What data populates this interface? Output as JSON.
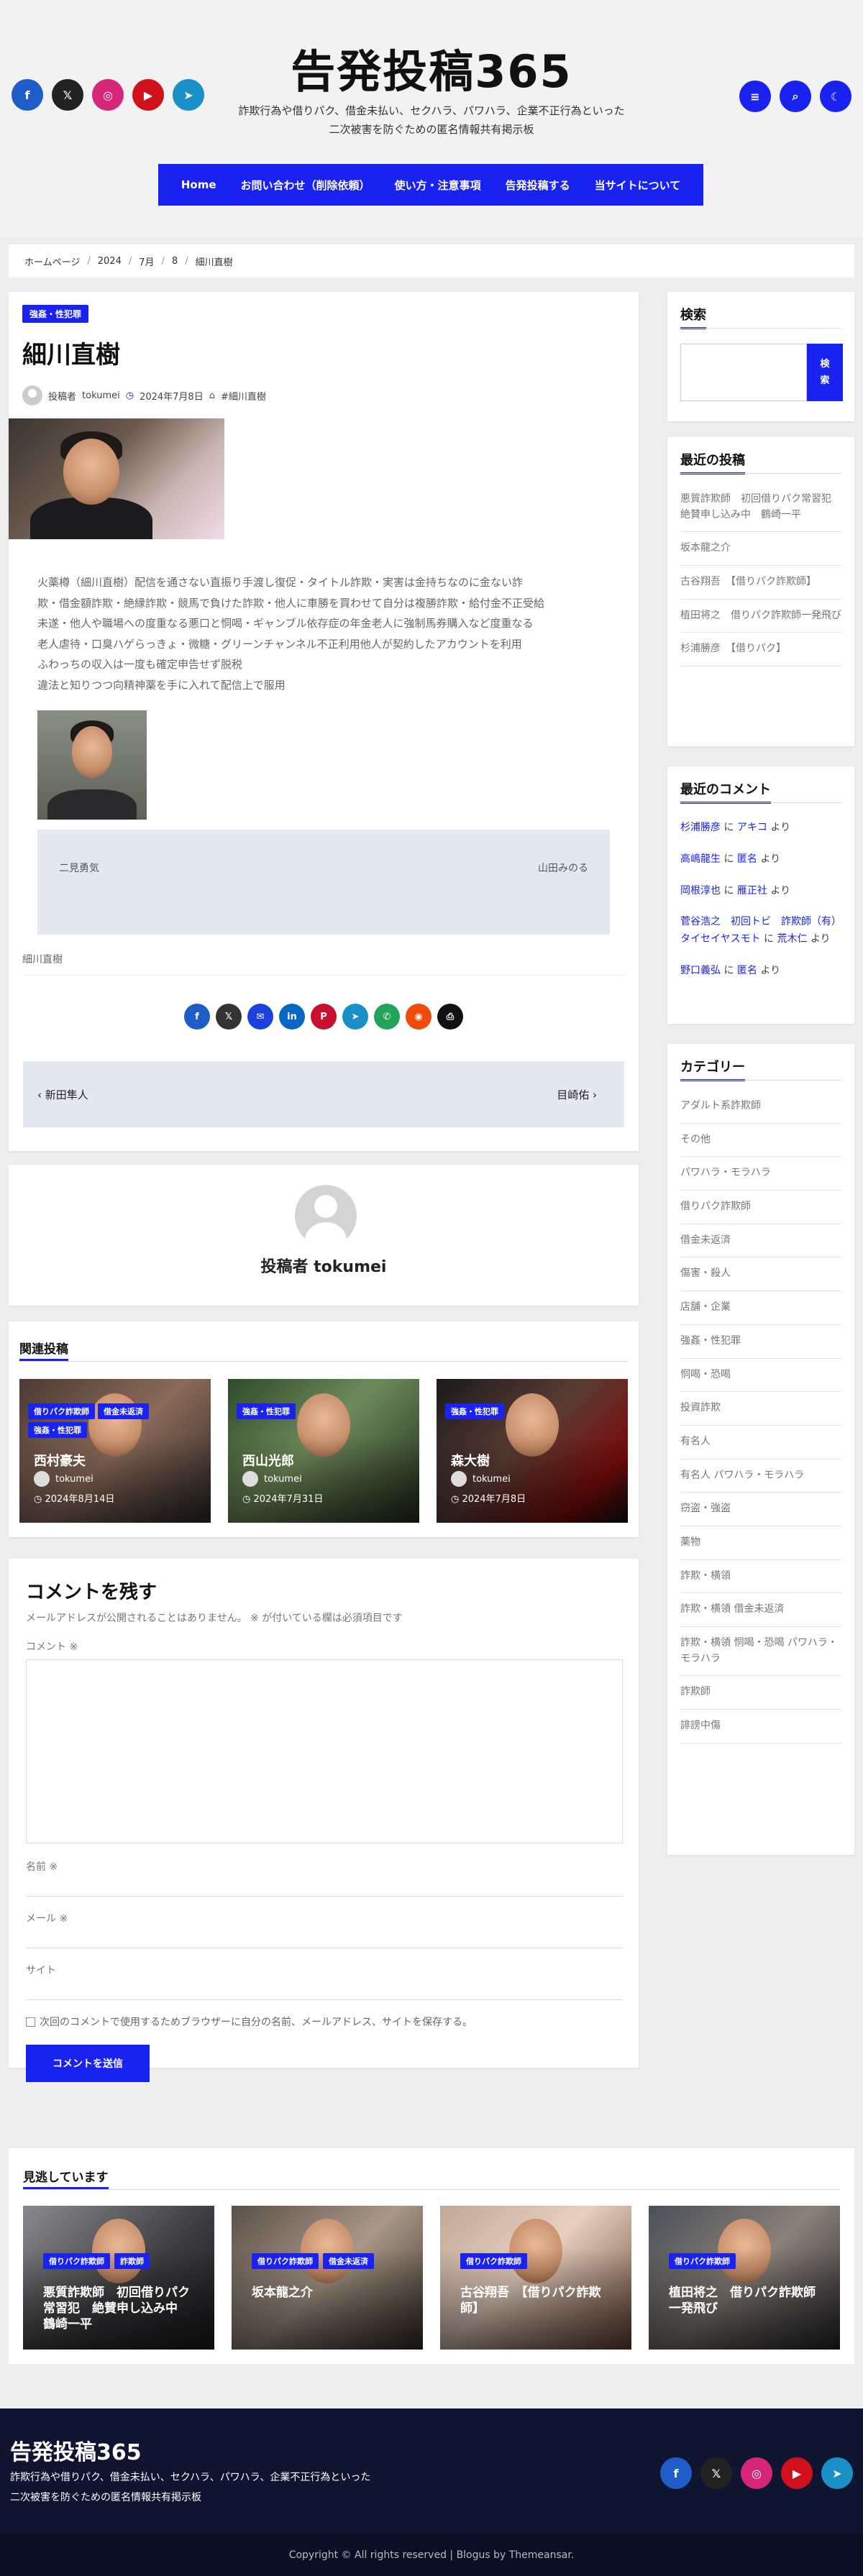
{
  "colors": {
    "accent": "#1a22f0",
    "nav_bg": "#1a22f0",
    "footer_bg": "#0f1530"
  },
  "header": {
    "site_title": "告発投稿365",
    "tagline_1": "詐欺行為や借りパク、借金未払い、セクハラ、パワハラ、企業不正行為といった",
    "tagline_2": "二次被害を防ぐための匿名情報共有掲示板",
    "social_left": [
      {
        "name": "facebook-icon",
        "glyph": "f",
        "color": "#1e5cc8"
      },
      {
        "name": "x-icon",
        "glyph": "𝕏",
        "color": "#222222"
      },
      {
        "name": "instagram-icon",
        "glyph": "◎",
        "color": "#d6267a"
      },
      {
        "name": "youtube-icon",
        "glyph": "▶",
        "color": "#d0101a"
      },
      {
        "name": "telegram-icon",
        "glyph": "➤",
        "color": "#1a90c8"
      }
    ],
    "social_right": [
      {
        "name": "menu-icon",
        "glyph": "≡",
        "color": "#1a22f0"
      },
      {
        "name": "search-icon",
        "glyph": "⌕",
        "color": "#1a22f0"
      },
      {
        "name": "dark-mode-icon",
        "glyph": "☾",
        "color": "#1a22f0"
      }
    ]
  },
  "nav": {
    "items": [
      "Home",
      "お問い合わせ（削除依頼）",
      "使い方・注意事項",
      "告発投稿する",
      "当サイトについて"
    ]
  },
  "breadcrumb": [
    "ホームページ",
    "2024",
    "7月",
    "8",
    "細川直樹"
  ],
  "article": {
    "category": "強姦・性犯罪",
    "title": "細川直樹",
    "author_prefix": "投稿者",
    "author": "tokumei",
    "date": "2024年7月8日",
    "tag": "#細川直樹",
    "body": [
      "火薬樽（細川直樹）配信を通さない直振り手渡し復促・タイトル詐欺・実害は金持ちなのに金ない詐",
      "欺・借金額詐欺・絶縁詐欺・競馬で負けた詐欺・他人に車勝を買わせて自分は複勝詐欺・給付金不正受給",
      "未遂・他人や職場への度重なる悪口と恫喝・ギャンブル依存症の年金老人に強制馬券購入など度重なる",
      "老人虐待・口臭ハゲらっきょ・微糖・グリーンチャンネル不正利用他人が契約したアカウントを利用",
      "ふわっちの収入は一度も確定申告せず脱税",
      "違法と知りつつ向精神薬を手に入れて配信上で服用"
    ],
    "post_nav_left_icon": "",
    "post_nav_left": "二見勇気",
    "post_nav_right": "山田みのる",
    "post_nav_right_icon": "",
    "footer_tag": "細川直樹",
    "share_icons": [
      {
        "name": "facebook-share-icon",
        "glyph": "f",
        "color": "#1e5cc8"
      },
      {
        "name": "x-share-icon",
        "glyph": "𝕏",
        "color": "#333333"
      },
      {
        "name": "messenger-share-icon",
        "glyph": "✉",
        "color": "#1a40e0"
      },
      {
        "name": "linkedin-share-icon",
        "glyph": "in",
        "color": "#0a66c2"
      },
      {
        "name": "pinterest-share-icon",
        "glyph": "P",
        "color": "#c8102e"
      },
      {
        "name": "telegram-share-icon",
        "glyph": "➤",
        "color": "#1a90c8"
      },
      {
        "name": "whatsapp-share-icon",
        "glyph": "✆",
        "color": "#22a35a"
      },
      {
        "name": "reddit-share-icon",
        "glyph": "◉",
        "color": "#f04a0c"
      },
      {
        "name": "print-share-icon",
        "glyph": "⎙",
        "color": "#111111"
      }
    ],
    "prev_label": "新田隼人",
    "next_label": "目崎佑",
    "prev_icon": "‹",
    "next_icon": "›"
  },
  "author_box": {
    "title": "投稿者 tokumei"
  },
  "related": {
    "title": "関連投稿",
    "posts": [
      {
        "cats": [
          "借りパク詐欺師",
          "借金未返済",
          "強姦・性犯罪"
        ],
        "title": "西村豪夫",
        "author": "tokumei",
        "date": "2024年8月14日",
        "bg": "linear-gradient(135deg,#4a3a34,#8a6a5a 50%,#2a2624)"
      },
      {
        "cats": [
          "強姦・性犯罪"
        ],
        "title": "西山光郎",
        "author": "tokumei",
        "date": "2024年7月31日",
        "bg": "linear-gradient(135deg,#2e4a2a,#6f8a5a 45%,#1e2a1a)"
      },
      {
        "cats": [
          "強姦・性犯罪"
        ],
        "title": "森大樹",
        "author": "tokumei",
        "date": "2024年7月8日",
        "bg": "linear-gradient(135deg,#1a1a1a,#5a3c34 45%,#7a0a0a 80%,#111)"
      }
    ]
  },
  "comment_form": {
    "title": "コメントを残す",
    "note": "メールアドレスが公開されることはありません。 ※ が付いている欄は必須項目です",
    "comment_label": "コメント ※",
    "name_label": "名前 ※",
    "email_label": "メール ※",
    "site_label": "サイト",
    "save_label": "次回のコメントで使用するためブラウザーに自分の名前、メールアドレス、サイトを保存する。",
    "submit_label": "コメントを送信"
  },
  "sidebar": {
    "search": {
      "title": "検索",
      "button": "検索"
    },
    "recent_posts": {
      "title": "最近の投稿",
      "items": [
        "悪質詐欺師　初回借りパク常習犯　絶賛申し込み中　鶴崎一平",
        "坂本龍之介",
        "古谷翔吾　【借りパク詐欺師】",
        "植田将之　借りパク詐欺師一発飛び",
        "杉浦勝彦　【借りパク】"
      ]
    },
    "recent_comments": {
      "title": "最近のコメント",
      "items": [
        {
          "who": "杉浦勝彦",
          "mid": " に ",
          "by": "アキコ",
          "end": " より"
        },
        {
          "who": "高嶋龍生",
          "mid": " に ",
          "by": "匿名",
          "end": " より"
        },
        {
          "who": "岡根淳也",
          "mid": " に ",
          "by": "雁正社",
          "end": " より"
        },
        {
          "who": "菅谷浩之　初回トビ　詐欺師（有）タイセイヤスモト",
          "mid": " に ",
          "by": "荒木仁",
          "end": " より"
        },
        {
          "who": "野口義弘",
          "mid": " に ",
          "by": "匿名",
          "end": " より"
        }
      ]
    },
    "categories": {
      "title": "カテゴリー",
      "items": [
        "アダルト系詐欺師",
        "その他",
        "パワハラ・モラハラ",
        "借りパク詐欺師",
        "借金未返済",
        "傷害・殺人",
        "店舗・企業",
        "強姦・性犯罪",
        "恫喝・恐喝",
        "投資詐欺",
        "有名人",
        "有名人 パワハラ・モラハラ",
        "窃盗・強盗",
        "薬物",
        "詐欺・横領",
        "詐欺・横領 借金未返済",
        "詐欺・横領 恫喝・恐喝 パワハラ・モラハラ",
        "詐欺師",
        "誹謗中傷"
      ]
    }
  },
  "seen": {
    "title": "見逃しています",
    "posts": [
      {
        "cats": [
          "借りパク詐欺師",
          "詐欺師"
        ],
        "title": "悪質詐欺師　初回借りパク常習犯　絶賛申し込み中　鶴崎一平",
        "bg": "linear-gradient(135deg,#8a8a8c,#3a3a3e 60%,#1a1a1e)"
      },
      {
        "cats": [
          "借りパク詐欺師",
          "借金未返済"
        ],
        "title": "坂本龍之介",
        "bg": "linear-gradient(135deg,#5a5048,#a89888 50%,#3a3028)"
      },
      {
        "cats": [
          "借りパク詐欺師"
        ],
        "title": "古谷翔吾　【借りパク詐欺師】",
        "bg": "linear-gradient(135deg,#c0a898,#e8d0c0 45%,#6a4a3a)"
      },
      {
        "cats": [
          "借りパク詐欺師"
        ],
        "title": "植田将之　借りパク詐欺師一発飛び",
        "bg": "linear-gradient(135deg,#4a5058,#8a8078 50%,#2a2a30)"
      }
    ]
  },
  "footer": {
    "title": "告発投稿365",
    "tagline_1": "詐欺行為や借りパク、借金未払い、セクハラ、パワハラ、企業不正行為といった",
    "tagline_2": "二次被害を防ぐための匿名情報共有掲示板",
    "social": [
      {
        "name": "facebook-icon",
        "glyph": "f",
        "color": "#1e5cc8"
      },
      {
        "name": "x-icon",
        "glyph": "𝕏",
        "color": "#222222"
      },
      {
        "name": "instagram-icon",
        "glyph": "◎",
        "color": "#d6267a"
      },
      {
        "name": "youtube-icon",
        "glyph": "▶",
        "color": "#d0101a"
      },
      {
        "name": "telegram-icon",
        "glyph": "➤",
        "color": "#1a90c8"
      }
    ],
    "copyright": "Copyright © All rights reserved | Blogus by Themeansar."
  }
}
